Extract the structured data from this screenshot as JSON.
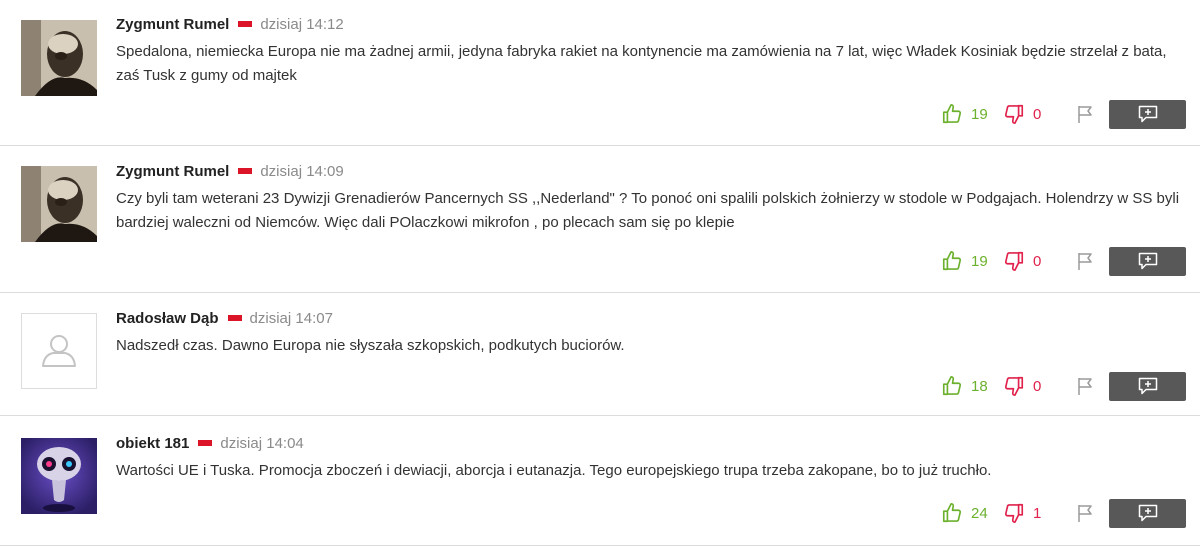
{
  "comments": [
    {
      "author": "Zygmunt Rumel",
      "time": "dzisiaj 14:12",
      "text": "Spedalona, niemiecka Europa nie ma żadnej armii, jedyna fabryka rakiet na kontynencie ma zamówienia na 7 lat, więc Władek Kosiniak będzie strzelał z bata, zaś Tusk z gumy od majtek",
      "likes": "19",
      "dislikes": "0",
      "avatar": "photo"
    },
    {
      "author": "Zygmunt Rumel",
      "time": "dzisiaj 14:09",
      "text": "Czy byli tam weterani 23 Dywizji Grenadierów Pancernych SS ,,Nederland\" ? To ponoć oni spalili polskich żołnierzy w stodole w Podgajach. Holendrzy w SS byli bardziej waleczni od Niemców. Więc dali POlaczkowi mikrofon , po plecach sam się po klepie",
      "likes": "19",
      "dislikes": "0",
      "avatar": "photo"
    },
    {
      "author": "Radosław Dąb",
      "time": "dzisiaj 14:07",
      "text": "Nadszedł czas. Dawno Europa nie słyszała szkopskich, podkutych buciorów.",
      "likes": "18",
      "dislikes": "0",
      "avatar": "placeholder"
    },
    {
      "author": "obiekt 181",
      "time": "dzisiaj 14:04",
      "text": "Wartości UE i Tuska. Promocja zboczeń i dewiacji, aborcja i eutanazja. Tego europejskiego trupa trzeba zakopane, bo to już truchło.",
      "likes": "24",
      "dislikes": "1",
      "avatar": "alien"
    }
  ],
  "colors": {
    "like": "#6cb12e",
    "dislike": "#e0224c",
    "reply_button": "#585858",
    "flag_pl": "#dc1427"
  },
  "icons": {
    "like": "thumbs-up-icon",
    "dislike": "thumbs-down-icon",
    "report": "flag-icon",
    "reply": "reply-plus-icon"
  }
}
